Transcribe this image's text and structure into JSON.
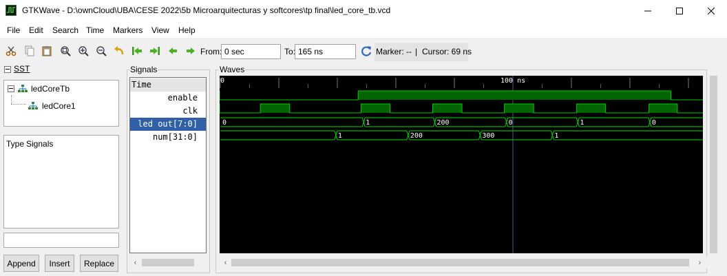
{
  "window": {
    "title": "GTKWave - D:\\ownCloud\\UBA\\CESE 2022\\5b Microarquitecturas y softcores\\tp final\\led_core_tb.vcd"
  },
  "menu": [
    "File",
    "Edit",
    "Search",
    "Time",
    "Markers",
    "View",
    "Help"
  ],
  "toolbar": {
    "icons": [
      "cut-icon",
      "copy-icon",
      "paste-icon",
      "zoom-fit-icon",
      "zoom-in-icon",
      "zoom-out-icon",
      "undo-zoom-icon",
      "zoom-to-start-icon",
      "zoom-to-end-icon",
      "find-previous-edge-icon",
      "find-next-edge-icon"
    ],
    "from_label": "From:",
    "from_value": "0 sec",
    "to_label": "To:",
    "to_value": "165 ns",
    "reload_icon": "reload-icon",
    "marker_label": "Marker: --",
    "separator": "|",
    "cursor_label": "Cursor: 69 ns"
  },
  "sst": {
    "label": "SST",
    "tree": [
      {
        "label": "ledCoreTb",
        "expanded": true
      },
      {
        "label": "ledCore1"
      }
    ],
    "type_header": "Type",
    "signals_header": "Signals",
    "filter_value": "",
    "buttons": {
      "append": "Append",
      "insert": "Insert",
      "replace": "Replace"
    }
  },
  "signals": {
    "label": "Signals",
    "header": "Time",
    "items": [
      {
        "name": "enable",
        "selected": false
      },
      {
        "name": "clk",
        "selected": false
      },
      {
        "name": "led out[7:0]",
        "selected": true
      },
      {
        "name": "num[31:0]",
        "selected": false
      }
    ]
  },
  "waves": {
    "label": "Waves",
    "time_start_label": "0",
    "time_marker_label": "100 ns",
    "enable_high": [
      47.1,
      154
    ],
    "clk_high": [
      [
        13.7,
        23.7
      ],
      [
        48.1,
        58
      ],
      [
        72.6,
        82.6
      ],
      [
        97.1,
        107.1
      ],
      [
        121.8,
        131.7
      ],
      [
        146.5,
        156.2
      ]
    ],
    "led_out": [
      {
        "t": 0,
        "label": "0"
      },
      {
        "t": 49,
        "label": "1"
      },
      {
        "t": 73.3,
        "label": "200"
      },
      {
        "t": 97.8,
        "label": "0"
      },
      {
        "t": 122.2,
        "label": "1"
      },
      {
        "t": 146.8,
        "label": "0"
      }
    ],
    "num": [
      {
        "t": 0,
        "label": ""
      },
      {
        "t": 39.5,
        "label": "1"
      },
      {
        "t": 64.2,
        "label": "200"
      },
      {
        "t": 88.8,
        "label": "300"
      },
      {
        "t": 113.5,
        "label": "1"
      }
    ],
    "range_ns": [
      0,
      162
    ],
    "cursor_ns": 100,
    "colors": {
      "trace": "#00cc00",
      "fill": "#006400",
      "bus": "#00dd00",
      "grid": "#303040",
      "cursor": "#4a5a9a",
      "label": "#ffffff"
    }
  }
}
